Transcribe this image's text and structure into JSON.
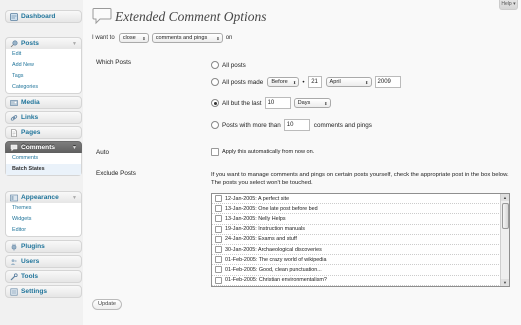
{
  "help_label": "Help",
  "sidebar": {
    "dashboard": "Dashboard",
    "posts": "Posts",
    "posts_sub": [
      "Edit",
      "Add New",
      "Tags",
      "Categories"
    ],
    "media": "Media",
    "links": "Links",
    "pages": "Pages",
    "comments": "Comments",
    "comments_sub": [
      "Comments",
      "Batch States"
    ],
    "appearance": "Appearance",
    "appearance_sub": [
      "Themes",
      "Widgets",
      "Editor"
    ],
    "plugins": "Plugins",
    "users": "Users",
    "tools": "Tools",
    "settings": "Settings"
  },
  "page": {
    "title": "Extended Comment Options",
    "intro_prefix": "I want to",
    "action_value": "close",
    "target_value": "comments and pings",
    "intro_suffix": "on"
  },
  "which_posts": {
    "label": "Which Posts",
    "all_posts": "All posts",
    "made_prefix": "All posts made",
    "made_relation": "Before",
    "made_day": "21",
    "made_month": "April",
    "made_year": "2009",
    "last_prefix": "All but the last",
    "last_value": "10",
    "last_unit": "Days",
    "more_prefix": "Posts with more than",
    "more_value": "10",
    "more_suffix": "comments and pings",
    "selected_option": "all-but-last"
  },
  "auto": {
    "label": "Auto",
    "text": "Apply this automatically from now on."
  },
  "exclude": {
    "label": "Exclude Posts",
    "description": "If you want to manage comments and pings on certain posts yourself, check the appropriate post in the box below. The posts you select won't be touched.",
    "posts": [
      "12-Jan-2005: A perfect site",
      "13-Jan-2005: One late post before bed",
      "13-Jan-2005: Nelly Helps",
      "19-Jan-2005: Instruction manuals",
      "24-Jan-2005: Exams and stuff",
      "30-Jan-2005: Archaeological discoveries",
      "01-Feb-2005: The crazy world of wikipedia",
      "01-Feb-2005: Good, clean punctuation...",
      "01-Feb-2005: Christian environmentalism?"
    ]
  },
  "update_label": "Update"
}
